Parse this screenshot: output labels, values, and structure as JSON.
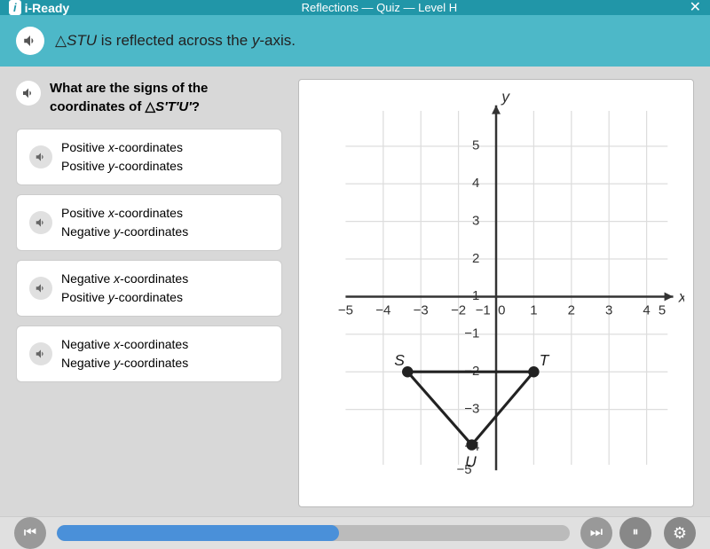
{
  "titleBar": {
    "logo": "i-Ready",
    "title": "Reflections — Quiz — Level H",
    "closeLabel": "✕"
  },
  "instructionBar": {
    "text": "△STU is reflected across the y-axis."
  },
  "question": {
    "speakerAria": "speaker",
    "text": "What are the signs of the coordinates of △S′T′U′?"
  },
  "options": [
    {
      "id": "opt1",
      "line1": "Positive x-coordinates",
      "line2": "Positive y-coordinates"
    },
    {
      "id": "opt2",
      "line1": "Positive x-coordinates",
      "line2": "Negative y-coordinates"
    },
    {
      "id": "opt3",
      "line1": "Negative x-coordinates",
      "line2": "Positive y-coordinates"
    },
    {
      "id": "opt4",
      "line1": "Negative x-coordinates",
      "line2": "Negative y-coordinates"
    }
  ],
  "graph": {
    "xAxisLabel": "x",
    "yAxisLabel": "y",
    "xMin": -5,
    "xMax": 5,
    "yMin": -5,
    "yMax": 5,
    "points": {
      "S": {
        "x": -2.5,
        "y": -2
      },
      "T": {
        "x": 1,
        "y": -2
      },
      "U": {
        "x": -0.8,
        "y": -4
      }
    }
  },
  "bottomBar": {
    "prevLabel": "⏮",
    "nextLabel": "⏭",
    "pauseLabel": "⏸",
    "settingsLabel": "⚙",
    "progressPercent": 55
  }
}
